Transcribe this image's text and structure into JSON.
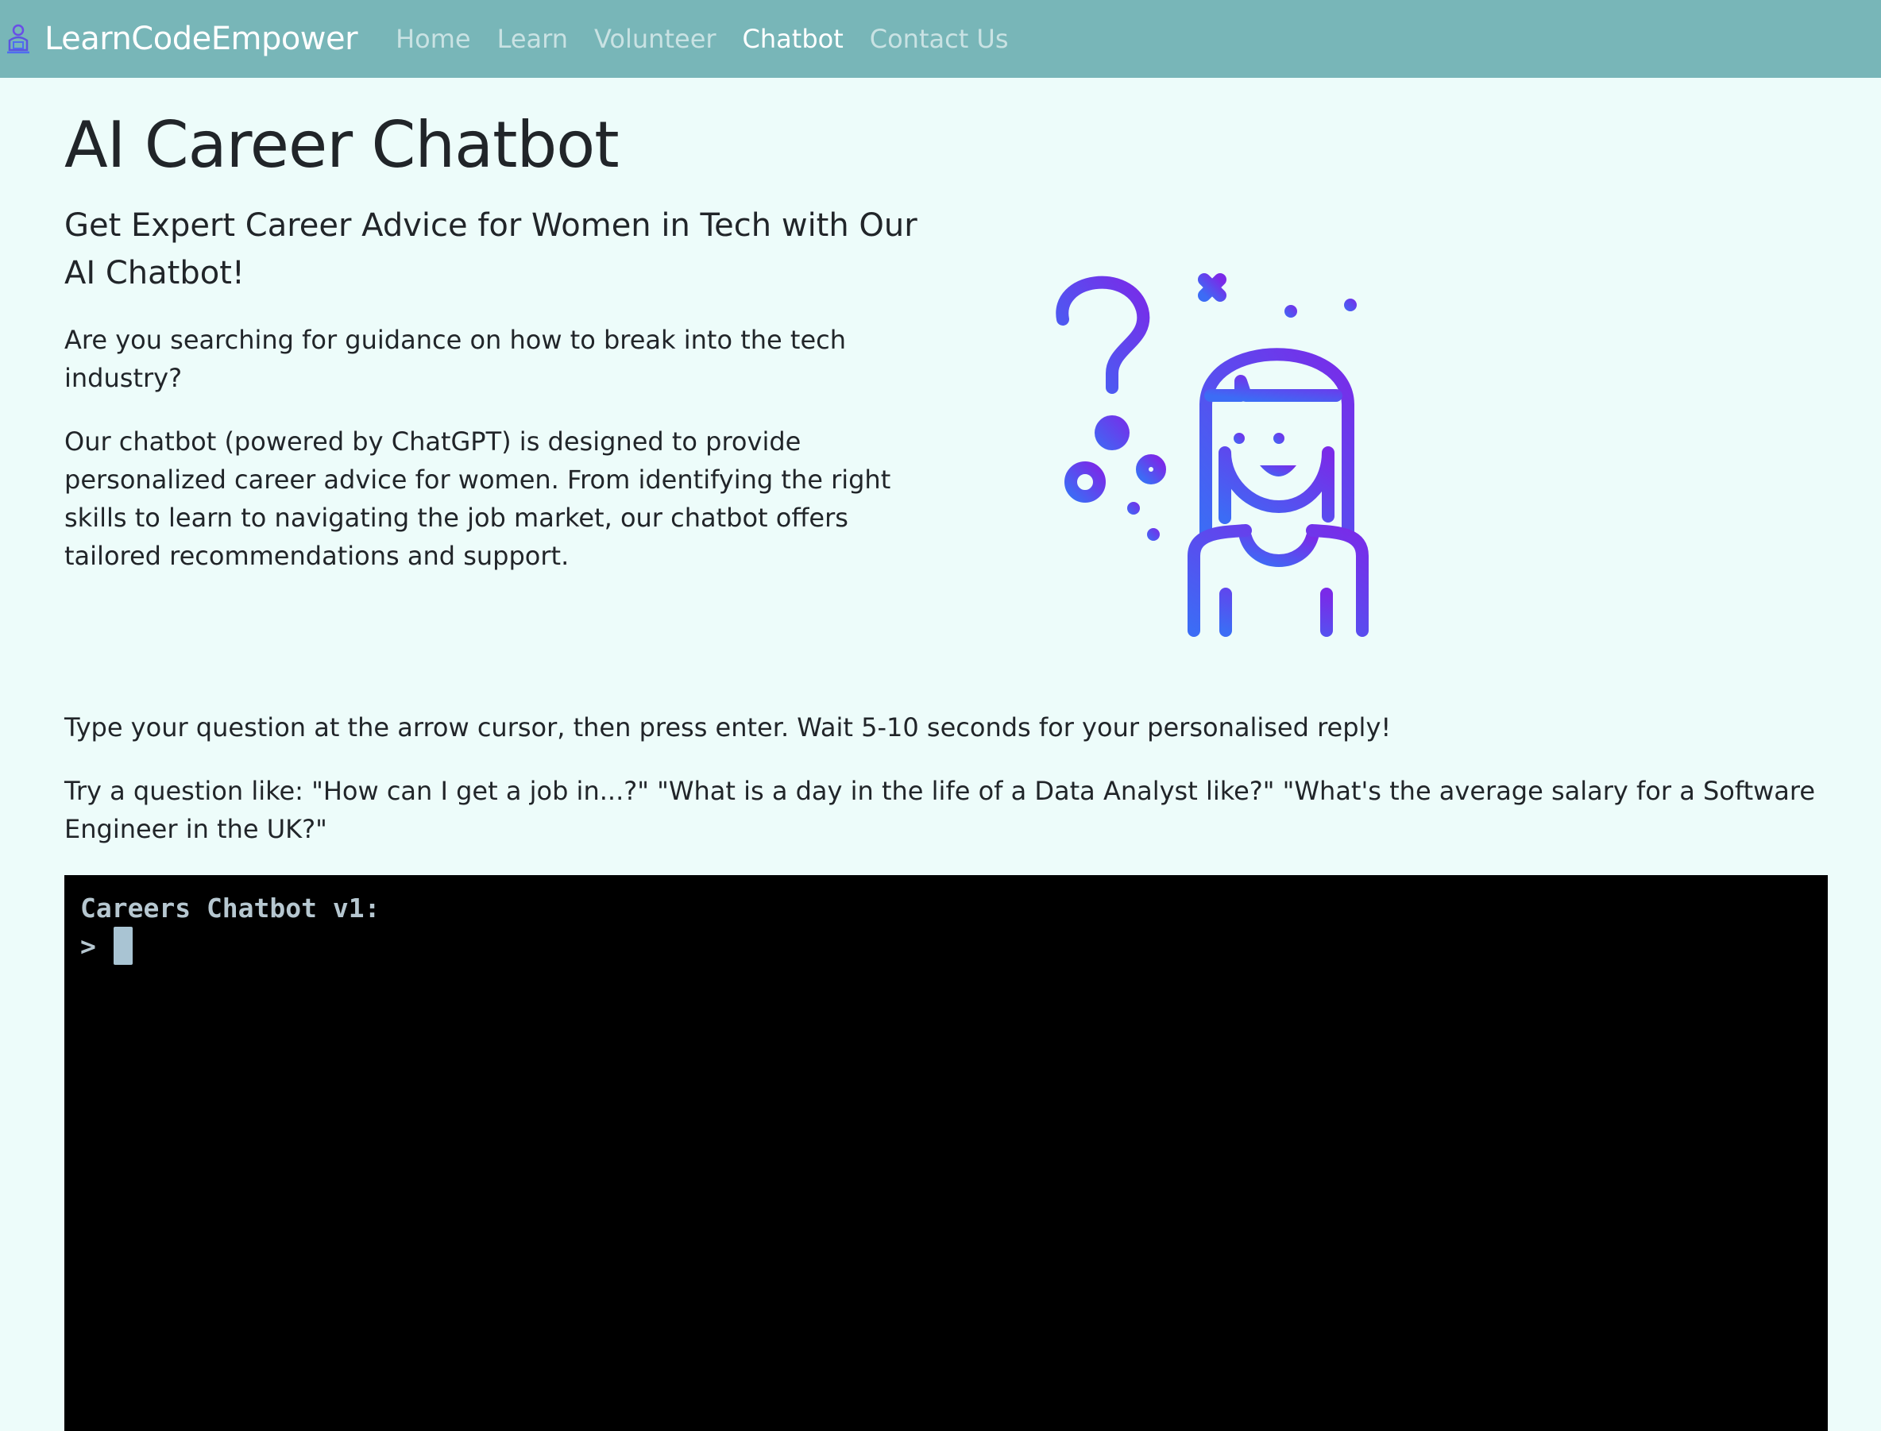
{
  "navbar": {
    "brand": "LearnCodeEmpower",
    "links": [
      {
        "label": "Home",
        "active": false
      },
      {
        "label": "Learn",
        "active": false
      },
      {
        "label": "Volunteer",
        "active": false
      },
      {
        "label": "Chatbot",
        "active": true
      },
      {
        "label": "Contact Us",
        "active": false
      }
    ],
    "background_color": "#78b6b8"
  },
  "main": {
    "title": "AI Career Chatbot",
    "subtitle": "Get Expert Career Advice for Women in Tech with Our AI Chatbot!",
    "intro_question": "Are you searching for guidance on how to break into the tech industry?",
    "description": "Our chatbot (powered by ChatGPT) is designed to provide personalized career advice for women. From identifying the right skills to learn to navigating the job market, our chatbot offers tailored recommendations and support.",
    "instructions": "Type your question at the arrow cursor, then press enter. Wait 5-10 seconds for your personalised reply!",
    "examples": "Try a question like: \"How can I get a job in...?\" \"What is a day in the life of a Data Analyst like?\" \"What's the average salary for a Software Engineer in the UK?\"",
    "illustration": "woman-question-icon",
    "page_background": "#edfcfa"
  },
  "terminal": {
    "greeting": "Careers Chatbot v1:",
    "prompt": ">",
    "input_value": "",
    "background_color": "#000000"
  }
}
